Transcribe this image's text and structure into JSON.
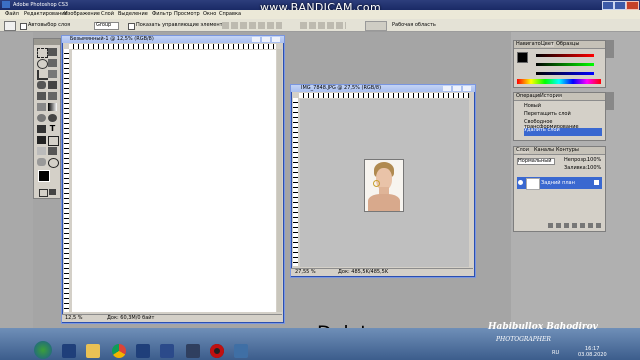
{
  "app": {
    "title": "Adobe Photoshop CS3",
    "watermark": "www.BANDICAM.com"
  },
  "menu": [
    "Файл",
    "Редактирование",
    "Изображение",
    "Слой",
    "Выделение",
    "Фильтр",
    "Просмотр",
    "Окно",
    "Справка"
  ],
  "optbar": {
    "autoselect": "Автовыбор слоя",
    "group_value": "Group",
    "transform": "Показать управляющие элементы",
    "workspace": "Рабочая область"
  },
  "doc1": {
    "title": "Безымянный-1 @ 12,5% (RGB/8)",
    "zoom": "12,5 %",
    "info": "Док: 60,3M/0 байт"
  },
  "doc2": {
    "title": "IMG_7848.JPG @ 27,5% (RGB/8)",
    "zoom": "27,55 %",
    "info": "Док: 485,5K/485,5K"
  },
  "color_panel": {
    "tabs": [
      "Навигатор",
      "Цвет",
      "Образцы"
    ]
  },
  "history_panel": {
    "tabs": [
      "Операции",
      "История"
    ],
    "items": [
      "Новый",
      "Перетащить слой",
      "Свободное трансформирование",
      "Удалить слой"
    ]
  },
  "layers_panel": {
    "tabs": [
      "Слои",
      "Каналы",
      "Контуры"
    ],
    "mode": "Нормальный",
    "opacity_label": "Непрозр.:",
    "opacity": "100%",
    "fill_label": "Заливка:",
    "fill": "100%",
    "layer": "Задний план"
  },
  "caption": "Delete",
  "signature": {
    "name": "Habibullox Bahodirov",
    "sub": "PHOTOGRAPHER"
  },
  "taskbar": {
    "lang": "RU",
    "time": "16:17",
    "date": "03.08.2020"
  }
}
